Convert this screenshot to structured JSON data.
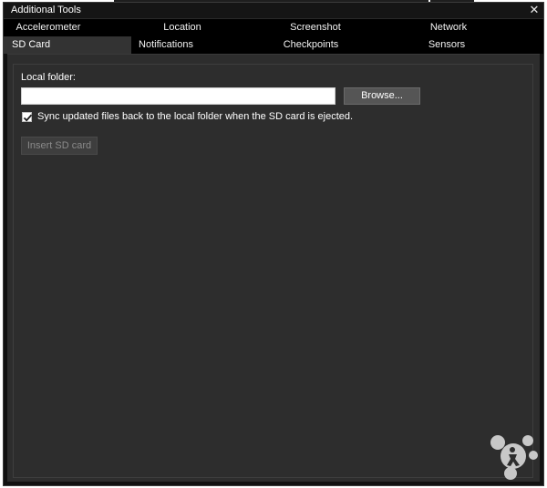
{
  "window": {
    "title": "Additional Tools",
    "close_glyph": "✕"
  },
  "tabs": {
    "row1": [
      "Accelerometer",
      "Location",
      "Screenshot",
      "Network"
    ],
    "row2": [
      "SD Card",
      "Notifications",
      "Checkpoints",
      "Sensors"
    ],
    "active": "SD Card"
  },
  "sd_card": {
    "local_folder_label": "Local folder:",
    "local_folder_value": "",
    "browse_label": "Browse...",
    "sync_label": "Sync updated files back to the local folder when the SD card is ejected.",
    "sync_checked": true,
    "insert_label": "Insert SD card"
  },
  "icons": {
    "close": "close-icon",
    "checkmark": "checkmark-icon",
    "logo": "tools-logo-icon"
  },
  "colors": {
    "window_bg": "#111111",
    "tab_bar_bg": "#000000",
    "active_tab_bg": "#333333",
    "panel_bg": "#2d2d2d",
    "button_bg": "#555555",
    "disabled_text": "#8a8a8a"
  }
}
